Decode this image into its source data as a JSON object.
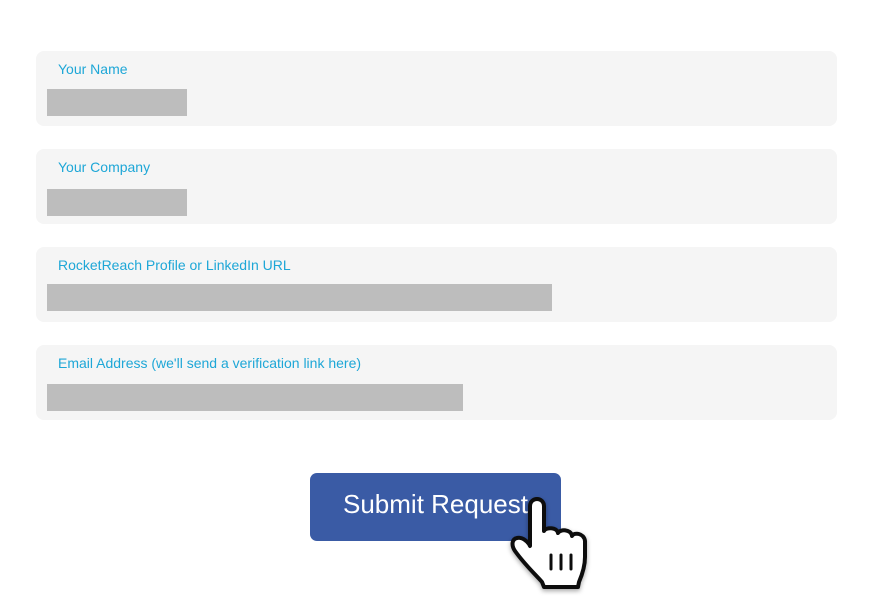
{
  "form": {
    "fields": [
      {
        "label": "Your Name",
        "value": ""
      },
      {
        "label": "Your Company",
        "value": ""
      },
      {
        "label": "RocketReach Profile or LinkedIn URL",
        "value": ""
      },
      {
        "label": "Email Address (we'll send a verification link here)",
        "value": ""
      }
    ],
    "submit_label": "Submit Request"
  },
  "colors": {
    "label": "#1ea7d7",
    "field_bg": "#f5f5f5",
    "redaction": "#bdbdbd",
    "button": "#3a5ba5",
    "button_text": "#ffffff"
  },
  "icons": {
    "cursor": "hand-pointer-icon"
  }
}
